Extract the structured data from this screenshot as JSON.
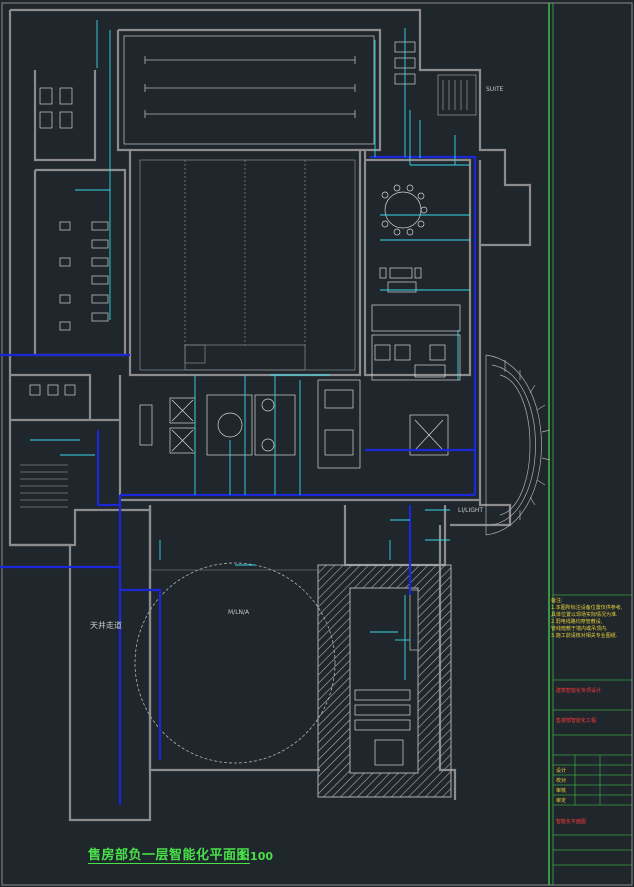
{
  "drawing": {
    "title": "售房部负一层智能化平面图",
    "scale": "1:100"
  },
  "labels": {
    "stair_top": "SUITE",
    "right_label": "LI/LIGHT",
    "hall_label": "天井走道",
    "area_b": "M/LN/A"
  },
  "notes": {
    "header": "备注:",
    "lines": [
      "1.本图所标注设备位置仅供参考,",
      "  具体位置以现场实际情况为准.",
      "2.弱电线路均穿管敷设,",
      "  管线暗敷于墙内或吊顶内.",
      "3.施工前请核对相关专业图纸."
    ]
  },
  "titleblock": {
    "company_red": "建筑智能化专项设计",
    "project_red": "售楼部智能化工程",
    "rows": [
      "设计",
      "校对",
      "审核",
      "审定"
    ],
    "bottom_red": "智能化平面图"
  },
  "colors": {
    "background": "#1f262c",
    "wall": "#8c8c8c",
    "blue_cable": "#1a28d8",
    "cyan": "#35d8e8",
    "green": "#49e04a",
    "yellow": "#e8d23a",
    "red": "#ff3a3a"
  }
}
